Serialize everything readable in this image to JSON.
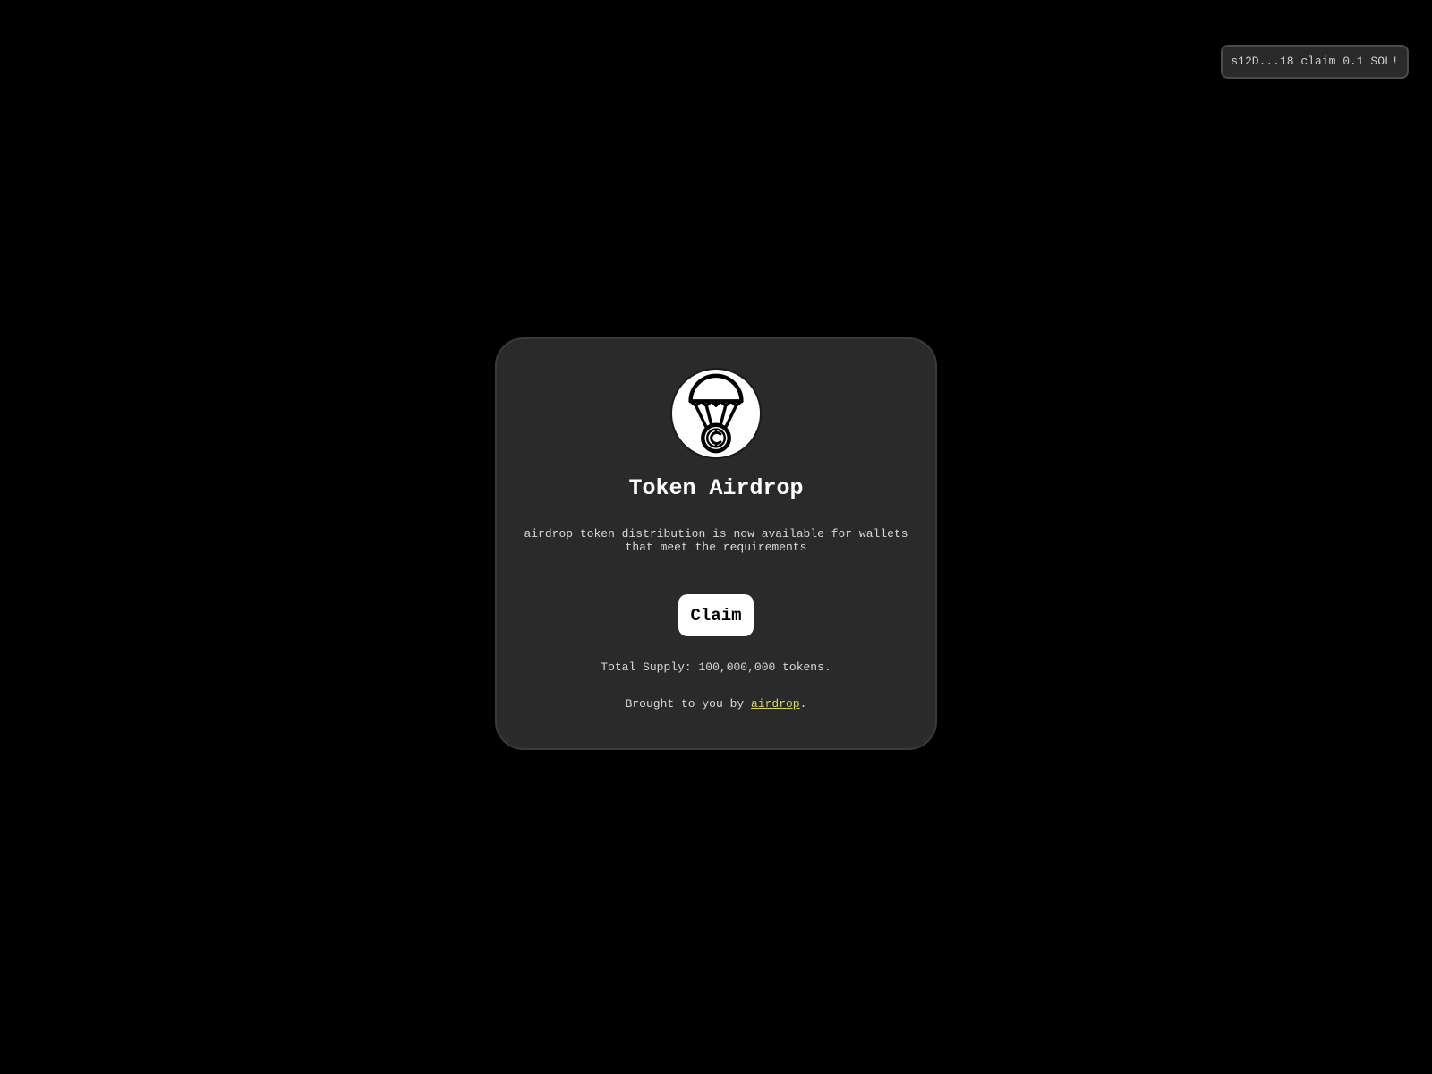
{
  "toast": {
    "text": "s12D...18 claim 0.1 SOL!"
  },
  "card": {
    "logo_icon": "parachute-coin-icon",
    "title": "Token Airdrop",
    "description": "airdrop token distribution is now available for wallets that meet the requirements",
    "claim_label": "Claim",
    "supply_text": "Total Supply: 100,000,000 tokens.",
    "brought_prefix": "Brought to you by ",
    "brought_link": "airdrop",
    "brought_suffix": "."
  },
  "colors": {
    "background": "#000000",
    "card": "#2a2a2a",
    "link": "#d9d45a",
    "button": "#ffffff"
  }
}
